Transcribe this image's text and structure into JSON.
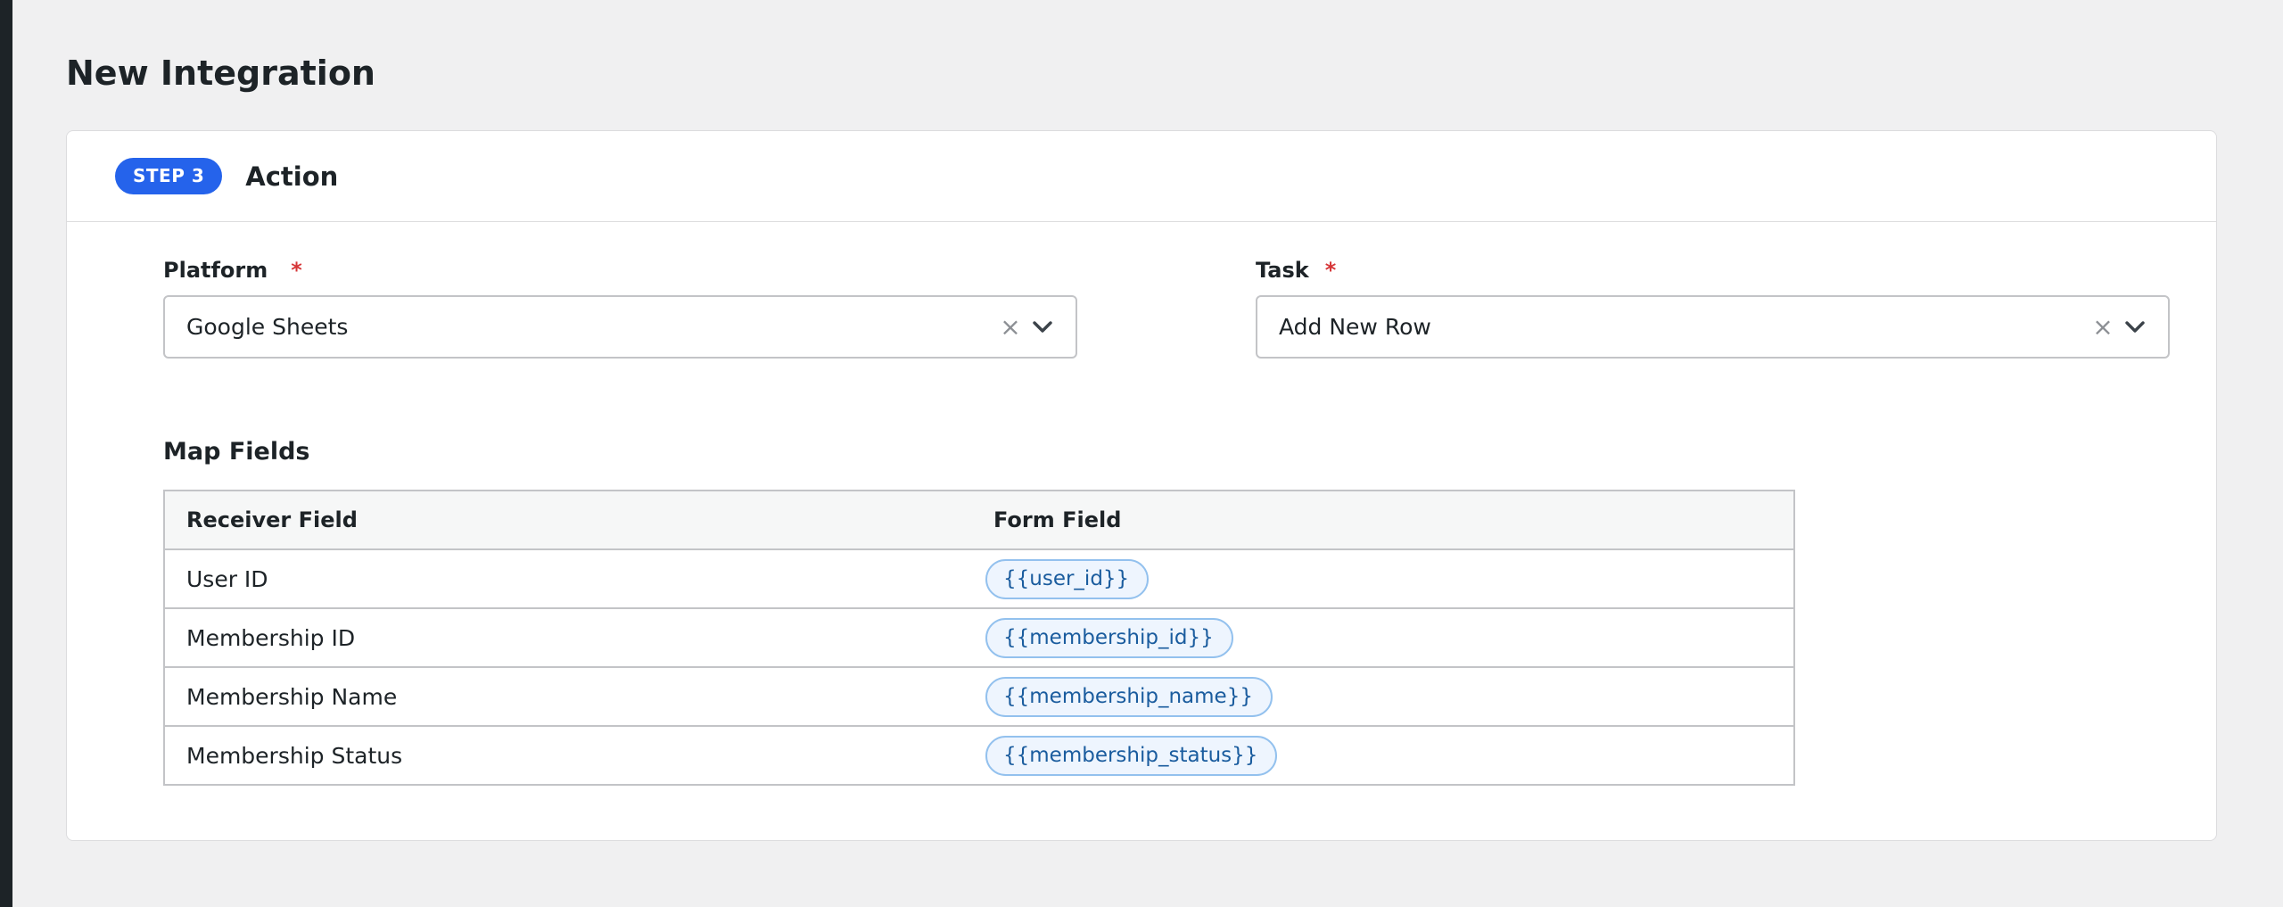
{
  "page": {
    "title": "New Integration"
  },
  "card": {
    "step_badge": "STEP 3",
    "title": "Action"
  },
  "platform": {
    "label": "Platform",
    "required_mark": "*",
    "value": "Google Sheets",
    "clear_glyph": "×"
  },
  "task": {
    "label": "Task",
    "required_mark": "*",
    "value": "Add New Row",
    "clear_glyph": "×"
  },
  "map_fields": {
    "title": "Map Fields",
    "headers": {
      "receiver": "Receiver Field",
      "form": "Form Field"
    },
    "rows": [
      {
        "receiver": "User ID",
        "form": "{{user_id}}"
      },
      {
        "receiver": "Membership ID",
        "form": "{{membership_id}}"
      },
      {
        "receiver": "Membership Name",
        "form": "{{membership_name}}"
      },
      {
        "receiver": "Membership Status",
        "form": "{{membership_status}}"
      }
    ]
  },
  "colors": {
    "accent": "#2563eb",
    "required": "#d63638",
    "tag_border": "#93c1ee",
    "tag_bg": "#eef5fe",
    "tag_text": "#1a5c9e"
  },
  "icons": {
    "clear": "close-icon",
    "dropdown": "chevron-down-icon"
  }
}
